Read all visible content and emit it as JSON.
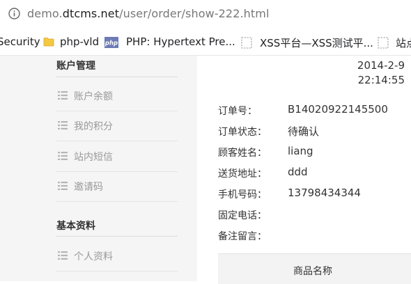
{
  "browser": {
    "url_prefix": "demo.",
    "url_host": "dtcms.net",
    "url_path": "/user/order/show-222.html"
  },
  "bookmarks": [
    {
      "label": "Security",
      "icon": "none"
    },
    {
      "label": "php-vld",
      "icon": "folder-icon"
    },
    {
      "label": "PHP: Hypertext Pre...",
      "icon": "php-icon"
    },
    {
      "label": "XSS平台—XSS测试平...",
      "icon": "page-icon"
    },
    {
      "label": "站点",
      "icon": "page-icon"
    }
  ],
  "sidebar": {
    "account_title": "账户管理",
    "account_items": [
      "账户余额",
      "我的积分",
      "站内短信",
      "邀请码"
    ],
    "profile_title": "基本资料",
    "profile_items": [
      "个人资料"
    ]
  },
  "order": {
    "date": "2014-2-9",
    "time": "22:14:55",
    "fields": [
      {
        "label": "订单号：",
        "value": "B14020922145500"
      },
      {
        "label": "订单状态：",
        "value": "待确认"
      },
      {
        "label": "顾客姓名：",
        "value": "liang"
      },
      {
        "label": "送货地址：",
        "value": "ddd"
      },
      {
        "label": "手机号码：",
        "value": "13798434344"
      },
      {
        "label": "固定电话：",
        "value": ""
      },
      {
        "label": "备注留言：",
        "value": ""
      }
    ],
    "goods_header": "商品名称"
  }
}
